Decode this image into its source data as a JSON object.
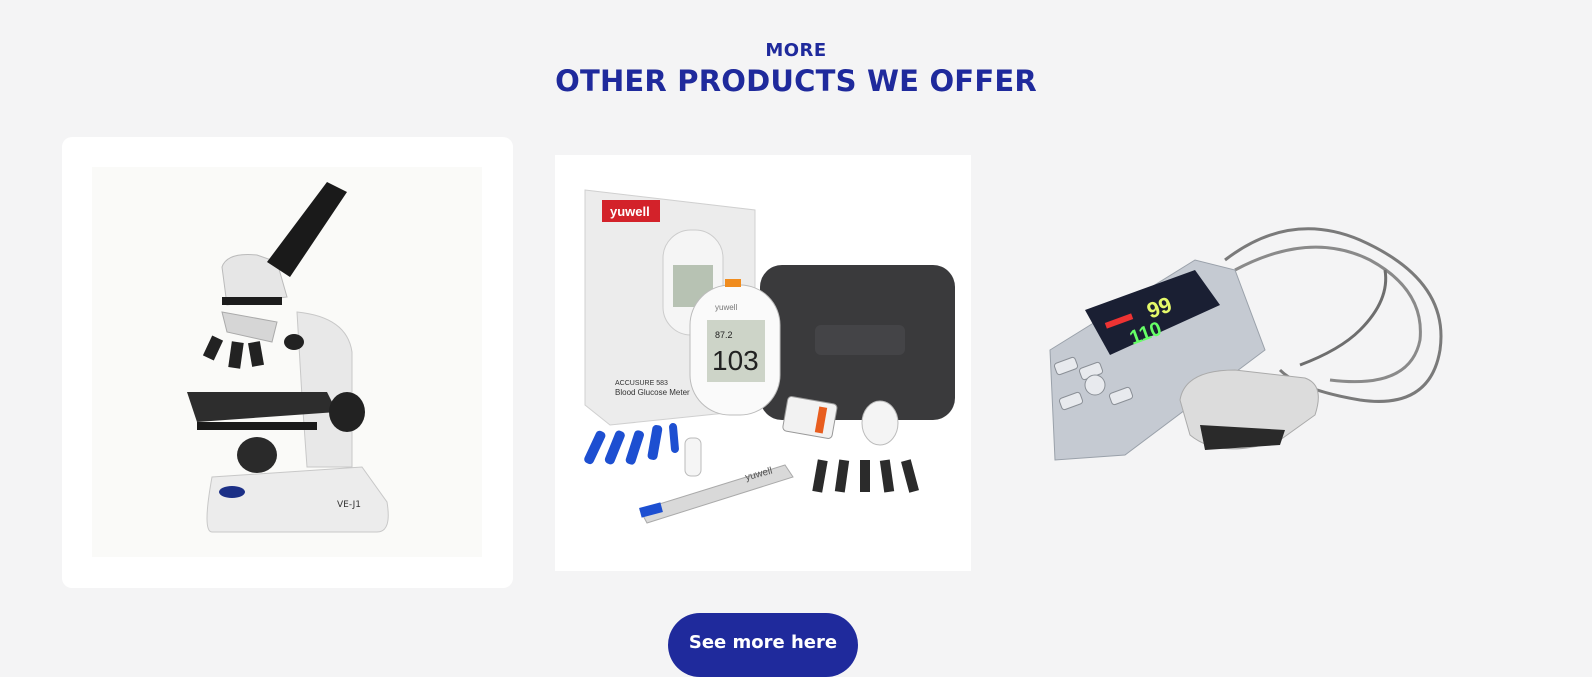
{
  "section": {
    "eyebrow": "MORE",
    "title": "OTHER PRODUCTS WE OFFER"
  },
  "products": [
    {
      "name": "microscope",
      "icon": "microscope-image",
      "model_label": "VE-J1"
    },
    {
      "name": "blood-glucose-meter-kit",
      "icon": "glucose-meter-image",
      "brand": "yuwell",
      "box_text_1": "ACCUSURE 583",
      "box_text_2": "Blood Glucose Meter",
      "reading": "103",
      "reading_small": "87.2"
    },
    {
      "name": "pulse-oximeter",
      "icon": "pulse-oximeter-image",
      "reading_1": "99",
      "reading_2": "110"
    }
  ],
  "cta": {
    "label": "See more here"
  },
  "colors": {
    "accent": "#1f2a9c",
    "background": "#f4f4f5",
    "card": "#ffffff"
  }
}
